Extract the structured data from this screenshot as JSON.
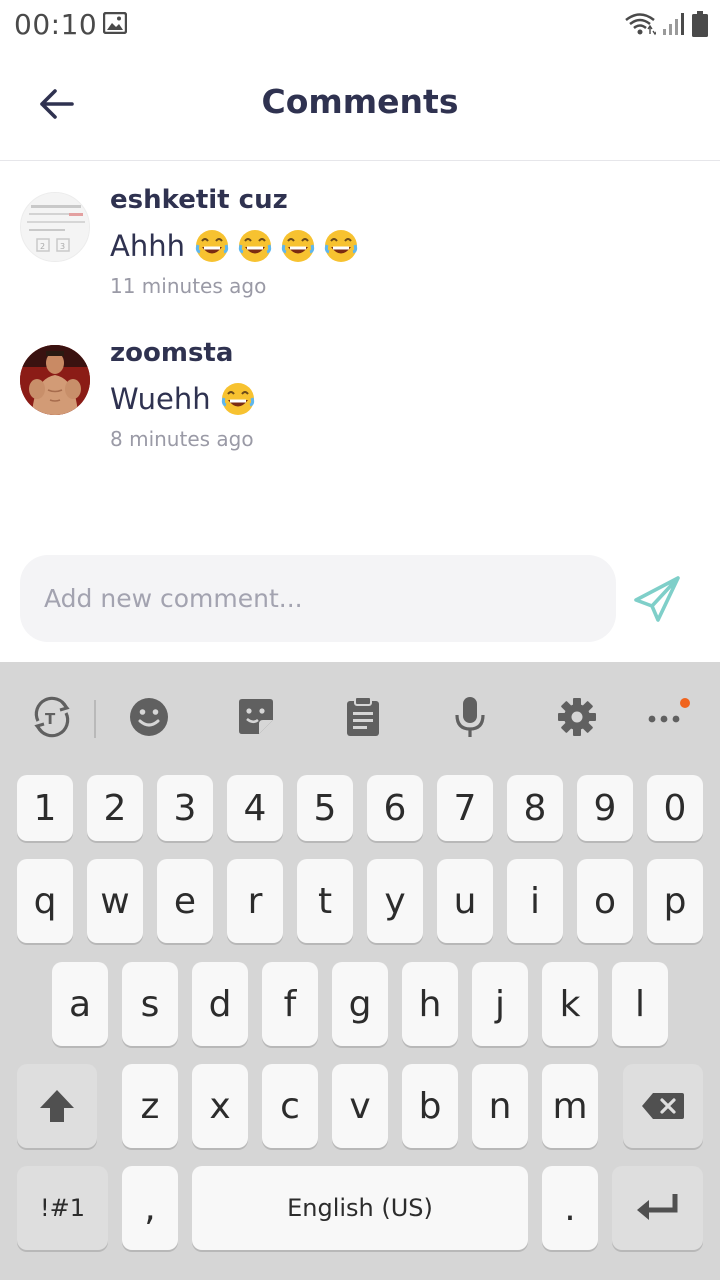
{
  "status_bar": {
    "time": "00:10",
    "icons": [
      "image-icon",
      "wifi-icon",
      "signal-icon",
      "battery-icon"
    ]
  },
  "header": {
    "title": "Comments",
    "back_icon": "arrow-left-icon"
  },
  "comments": [
    {
      "author": "eshketit cuz",
      "text": "Ahhh",
      "emojis": [
        "face-with-tears-of-joy",
        "face-with-tears-of-joy",
        "face-with-tears-of-joy",
        "face-with-tears-of-joy"
      ],
      "time": "11 minutes ago"
    },
    {
      "author": "zoomsta",
      "text": "Wuehh",
      "emojis": [
        "face-with-tears-of-joy"
      ],
      "time": "8 minutes ago"
    }
  ],
  "composer": {
    "placeholder": "Add new comment...",
    "value": "",
    "send_icon": "paper-plane-icon",
    "accent_color": "#7fcfc9"
  },
  "keyboard": {
    "toolbar_icons": [
      "translate-icon",
      "emoji-icon",
      "sticker-icon",
      "clipboard-icon",
      "microphone-icon",
      "gear-icon",
      "more-icon"
    ],
    "row_numbers": [
      "1",
      "2",
      "3",
      "4",
      "5",
      "6",
      "7",
      "8",
      "9",
      "0"
    ],
    "row_1": [
      "q",
      "w",
      "e",
      "r",
      "t",
      "y",
      "u",
      "i",
      "o",
      "p"
    ],
    "row_2": [
      "a",
      "s",
      "d",
      "f",
      "g",
      "h",
      "j",
      "k",
      "l"
    ],
    "row_3": [
      "z",
      "x",
      "c",
      "v",
      "b",
      "n",
      "m"
    ],
    "symbols_key": "!#1",
    "comma_key": ",",
    "space_key": "English (US)",
    "period_key": "."
  }
}
